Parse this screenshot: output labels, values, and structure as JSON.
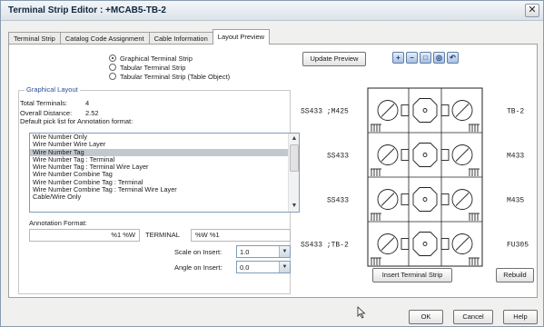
{
  "window": {
    "title": "Terminal Strip Editor : +MCAB5-TB-2",
    "close_glyph": "✕"
  },
  "tabs": [
    {
      "label": "Terminal Strip",
      "active": false
    },
    {
      "label": "Catalog Code Assignment",
      "active": false
    },
    {
      "label": "Cable Information",
      "active": false
    },
    {
      "label": "Layout Preview",
      "active": true
    }
  ],
  "layout_type": {
    "options": [
      "Graphical Terminal Strip",
      "Tabular Terminal Strip",
      "Tabular Terminal Strip (Table Object)"
    ],
    "selected_index": 0
  },
  "graphical_layout": {
    "legend": "Graphical Layout",
    "total_terminals_label": "Total Terminals:",
    "total_terminals_value": "4",
    "overall_distance_label": "Overall Distance:",
    "overall_distance_value": "2.52",
    "picklist_hint": "Default pick list for Annotation format:",
    "picklist": [
      "Wire Number Only",
      "Wire Number Wire Layer",
      "Wire Number Tag",
      "Wire Number Tag : Terminal",
      "Wire Number Tag : Terminal Wire Layer",
      "Wire Number Combine Tag",
      "Wire Number Combine Tag : Terminal",
      "Wire Number Combine Tag : Terminal Wire Layer",
      "Cable/Wire Only"
    ],
    "picklist_selected_index": 2,
    "annotation_label": "Annotation Format:",
    "annotation_left": "%1 %W",
    "annotation_middle": "TERMINAL",
    "annotation_right": "%W %1",
    "scale_label": "Scale on Insert:",
    "scale_value": "1.0",
    "angle_label": "Angle on Insert:",
    "angle_value": "0.0"
  },
  "preview": {
    "update_label": "Update Preview",
    "zoom_tools": [
      "zoom-in-icon",
      "zoom-out-icon",
      "zoom-window-icon",
      "zoom-extents-icon",
      "zoom-previous-icon"
    ],
    "left_labels": [
      "SS433 ;M425",
      "SS433",
      "SS433",
      "SS433 ;TB-2"
    ],
    "right_labels": [
      "TB-2",
      "M433",
      "M435",
      "FU305"
    ]
  },
  "actions": {
    "insert_label": "Insert Terminal Strip",
    "rebuild_label": "Rebuild",
    "ok_label": "OK",
    "cancel_label": "Cancel",
    "help_label": "Help"
  },
  "colors": {
    "legend_blue": "#2c4f96",
    "selection_gray": "#c2c8d0"
  }
}
